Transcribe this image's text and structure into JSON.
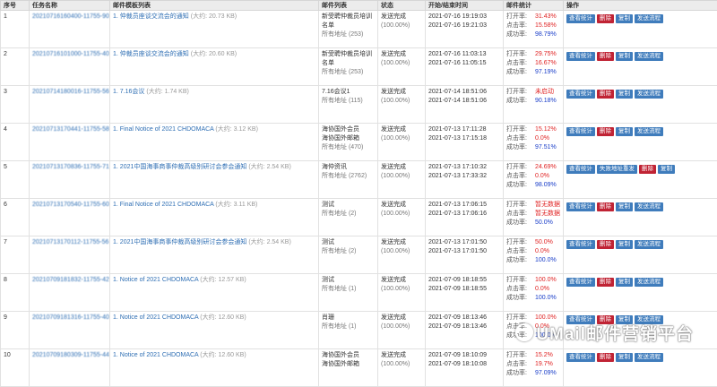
{
  "headers": [
    "序号",
    "任务名称",
    "邮件模板列表",
    "邮件列表",
    "状态",
    "开始/结束时间",
    "邮件统计",
    "操作"
  ],
  "stat_labels": {
    "open": "打开率:",
    "click": "点击率:",
    "success": "成功率:"
  },
  "size_prefix": "(大约:",
  "size_suffix": ")",
  "rows": [
    {
      "no": "1",
      "task": "20210716160400-11755-90",
      "tpl_no": "1.",
      "tpl_name": "仲裁员座谈交流会的通知",
      "tpl_size": "20.73 KB",
      "list1": "新受聘仲裁员培训",
      "list2": "名单",
      "list_sub": "所有地址 (253)",
      "status": "发送完成",
      "status_pct": "(100.00%)",
      "start": "2021-07-16 19:19:03",
      "end": "2021-07-16 19:21:03",
      "open": "31.43%",
      "open_c": "red",
      "click": "15.58%",
      "click_c": "red",
      "success": "98.79%",
      "success_c": "blue",
      "actions": [
        {
          "l": "查看统计",
          "c": "blue"
        },
        {
          "l": "删除",
          "c": "red"
        },
        {
          "l": "复制",
          "c": "blue"
        },
        {
          "l": "发送流程",
          "c": "blue"
        }
      ]
    },
    {
      "no": "2",
      "task": "20210716101000-11755-40",
      "tpl_no": "1.",
      "tpl_name": "仲裁员座谈交流会的通知",
      "tpl_size": "20.60 KB",
      "list1": "新受聘仲裁员培训",
      "list2": "名单",
      "list_sub": "所有地址 (253)",
      "status": "发送完成",
      "status_pct": "(100.00%)",
      "start": "2021-07-16 11:03:13",
      "end": "2021-07-16 11:05:15",
      "open": "29.75%",
      "open_c": "red",
      "click": "16.67%",
      "click_c": "red",
      "success": "97.19%",
      "success_c": "blue",
      "actions": [
        {
          "l": "查看统计",
          "c": "blue"
        },
        {
          "l": "删除",
          "c": "red"
        },
        {
          "l": "复制",
          "c": "blue"
        },
        {
          "l": "发送流程",
          "c": "blue"
        }
      ]
    },
    {
      "no": "3",
      "task": "20210714180016-11755-56",
      "tpl_no": "1.",
      "tpl_name": "7.16会议",
      "tpl_size": "1.74 KB",
      "list1": "7.16会议1",
      "list2": "",
      "list_sub": "所有地址 (115)",
      "status": "发送完成",
      "status_pct": "(100.00%)",
      "start": "2021-07-14 18:51:06",
      "end": "2021-07-14 18:51:06",
      "open": "未启动",
      "open_c": "red",
      "click": "",
      "click_c": "",
      "success": "90.18%",
      "success_c": "blue",
      "actions": [
        {
          "l": "查看统计",
          "c": "blue"
        },
        {
          "l": "删除",
          "c": "red"
        },
        {
          "l": "复制",
          "c": "blue"
        },
        {
          "l": "发送流程",
          "c": "blue"
        }
      ]
    },
    {
      "no": "4",
      "task": "20210713170441-11755-58",
      "tpl_no": "1.",
      "tpl_name": "Final Notice of 2021 CHDOMACA",
      "tpl_size": "3.12 KB",
      "list1": "海协国外会员",
      "list2": "海协国外邮箱",
      "list_sub": "所有地址 (470)",
      "status": "发送完成",
      "status_pct": "(100.00%)",
      "start": "2021-07-13 17:11:28",
      "end": "2021-07-13 17:15:18",
      "open": "15.12%",
      "open_c": "red",
      "click": "0.0%",
      "click_c": "red",
      "success": "97.51%",
      "success_c": "blue",
      "actions": [
        {
          "l": "查看统计",
          "c": "blue"
        },
        {
          "l": "删除",
          "c": "red"
        },
        {
          "l": "复制",
          "c": "blue"
        },
        {
          "l": "发送流程",
          "c": "blue"
        }
      ]
    },
    {
      "no": "5",
      "task": "20210713170836-11755-71",
      "tpl_no": "1.",
      "tpl_name": "2021中国海事商事仲裁高级别研讨会参会通知",
      "tpl_size": "2.54 KB",
      "list1": "海仲资讯",
      "list2": "",
      "list_sub": "所有地址 (2762)",
      "status": "发送完成",
      "status_pct": "(100.00%)",
      "start": "2021-07-13 17:10:32",
      "end": "2021-07-13 17:33:32",
      "open": "24.69%",
      "open_c": "red",
      "click": "0.0%",
      "click_c": "red",
      "success": "98.09%",
      "success_c": "blue",
      "actions": [
        {
          "l": "查看统计",
          "c": "blue"
        },
        {
          "l": "失败地址重发",
          "c": "blue"
        },
        {
          "l": "删除",
          "c": "red"
        },
        {
          "l": "复制",
          "c": "blue"
        }
      ]
    },
    {
      "no": "6",
      "task": "20210713170540-11755-60",
      "tpl_no": "1.",
      "tpl_name": "Final Notice of 2021 CHDOMACA",
      "tpl_size": "3.11 KB",
      "list1": "测试",
      "list2": "",
      "list_sub": "所有地址 (2)",
      "status": "发送完成",
      "status_pct": "(100.00%)",
      "start": "2021-07-13 17:06:15",
      "end": "2021-07-13 17:06:16",
      "open": "暂无数据",
      "open_c": "red",
      "click": "暂无数据",
      "click_c": "red",
      "success": "50.0%",
      "success_c": "blue",
      "actions": [
        {
          "l": "查看统计",
          "c": "blue"
        },
        {
          "l": "删除",
          "c": "red"
        },
        {
          "l": "复制",
          "c": "blue"
        },
        {
          "l": "发送流程",
          "c": "blue"
        }
      ]
    },
    {
      "no": "7",
      "task": "20210713170112-11755-56",
      "tpl_no": "1.",
      "tpl_name": "2021中国海事商事仲裁高级别研讨会参会通知",
      "tpl_size": "2.54 KB",
      "list1": "测试",
      "list2": "",
      "list_sub": "所有地址 (2)",
      "status": "发送完成",
      "status_pct": "(100.00%)",
      "start": "2021-07-13 17:01:50",
      "end": "2021-07-13 17:01:50",
      "open": "50.0%",
      "open_c": "red",
      "click": "0.0%",
      "click_c": "red",
      "success": "100.0%",
      "success_c": "blue",
      "actions": [
        {
          "l": "查看统计",
          "c": "blue"
        },
        {
          "l": "删除",
          "c": "red"
        },
        {
          "l": "复制",
          "c": "blue"
        },
        {
          "l": "发送流程",
          "c": "blue"
        }
      ]
    },
    {
      "no": "8",
      "task": "20210709181832-11755-42",
      "tpl_no": "1.",
      "tpl_name": "Notice of 2021 CHDOMACA",
      "tpl_size": "12.57 KB",
      "list1": "测试",
      "list2": "",
      "list_sub": "所有地址 (1)",
      "status": "发送完成",
      "status_pct": "(100.00%)",
      "start": "2021-07-09 18:18:55",
      "end": "2021-07-09 18:18:55",
      "open": "100.0%",
      "open_c": "red",
      "click": "0.0%",
      "click_c": "red",
      "success": "100.0%",
      "success_c": "blue",
      "actions": [
        {
          "l": "查看统计",
          "c": "blue"
        },
        {
          "l": "删除",
          "c": "red"
        },
        {
          "l": "复制",
          "c": "blue"
        },
        {
          "l": "发送流程",
          "c": "blue"
        }
      ]
    },
    {
      "no": "9",
      "task": "20210709181316-11755-40",
      "tpl_no": "1.",
      "tpl_name": "Notice of 2021 CHDOMACA",
      "tpl_size": "12.60 KB",
      "list1": "肖珊",
      "list2": "",
      "list_sub": "所有地址 (1)",
      "status": "发送完成",
      "status_pct": "(100.00%)",
      "start": "2021-07-09 18:13:46",
      "end": "2021-07-09 18:13:46",
      "open": "100.0%",
      "open_c": "red",
      "click": "0.0%",
      "click_c": "red",
      "success": "100.0%",
      "success_c": "blue",
      "actions": [
        {
          "l": "查看统计",
          "c": "blue"
        },
        {
          "l": "删除",
          "c": "red"
        },
        {
          "l": "复制",
          "c": "blue"
        },
        {
          "l": "发送流程",
          "c": "blue"
        }
      ]
    },
    {
      "no": "10",
      "task": "20210709180309-11755-44",
      "tpl_no": "1.",
      "tpl_name": "Notice of 2021 CHDOMACA",
      "tpl_size": "12.60 KB",
      "list1": "海协国外会员",
      "list2": "海协国外邮箱",
      "list_sub": "",
      "status": "发送完成",
      "status_pct": "(100.00%)",
      "start": "2021-07-09 18:10:09",
      "end": "2021-07-09 18:10:08",
      "open": "15.2%",
      "open_c": "red",
      "click": "19.7%",
      "click_c": "red",
      "success": "97.09%",
      "success_c": "blue",
      "actions": [
        {
          "l": "查看统计",
          "c": "blue"
        },
        {
          "l": "删除",
          "c": "red"
        },
        {
          "l": "复制",
          "c": "blue"
        },
        {
          "l": "发送流程",
          "c": "blue"
        }
      ]
    }
  ],
  "watermark": "UMail邮件营销平台"
}
